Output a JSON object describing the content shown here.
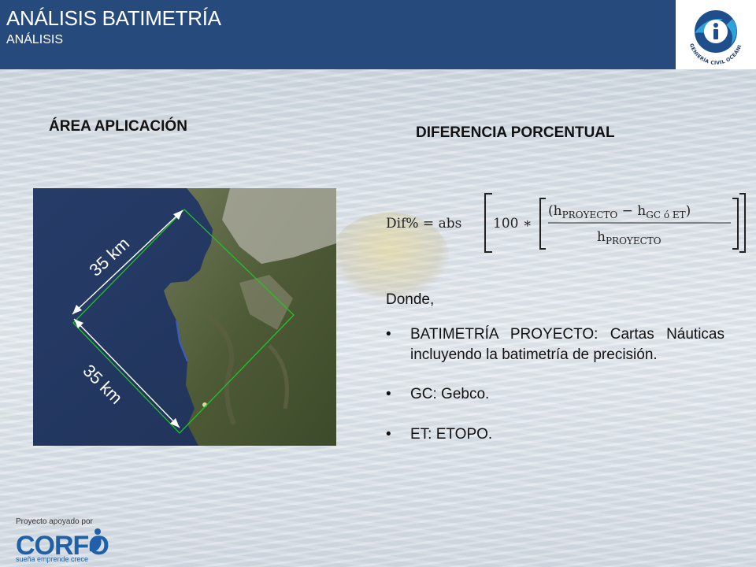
{
  "header": {
    "title": "ANÁLISIS BATIMETRÍA",
    "subtitle": "ANÁLISIS",
    "logo_text": "INGENIERÍA CIVIL OCEÁNICA"
  },
  "left": {
    "heading": "ÁREA APLICACIÓN",
    "map_labels": {
      "top": "35 km",
      "bottom": "35 km"
    }
  },
  "right": {
    "heading": "DIFERENCIA PORCENTUAL",
    "formula": {
      "lhs": "Dif% = abs",
      "factor": "100 ∗",
      "numerator": "(h",
      "num_sub1": "PROYECTO",
      "minus": " − h",
      "num_sub2": "GC ó ET",
      "num_close": ")",
      "denominator": "h",
      "den_sub": "PROYECTO"
    },
    "donde": "Donde,",
    "bullets": [
      "BATIMETRÍA PROYECTO: Cartas Náuticas  incluyendo la batimetría de precisión.",
      "GC: Gebco.",
      "ET: ETOPO."
    ]
  },
  "footer": {
    "caption": "Proyecto apoyado por",
    "brand": "CORFO",
    "tagline": "sueña emprende crece"
  },
  "colors": {
    "header_bg": "#274a7c",
    "corfo_blue": "#1f61a8",
    "rect_green": "#22c22a"
  }
}
